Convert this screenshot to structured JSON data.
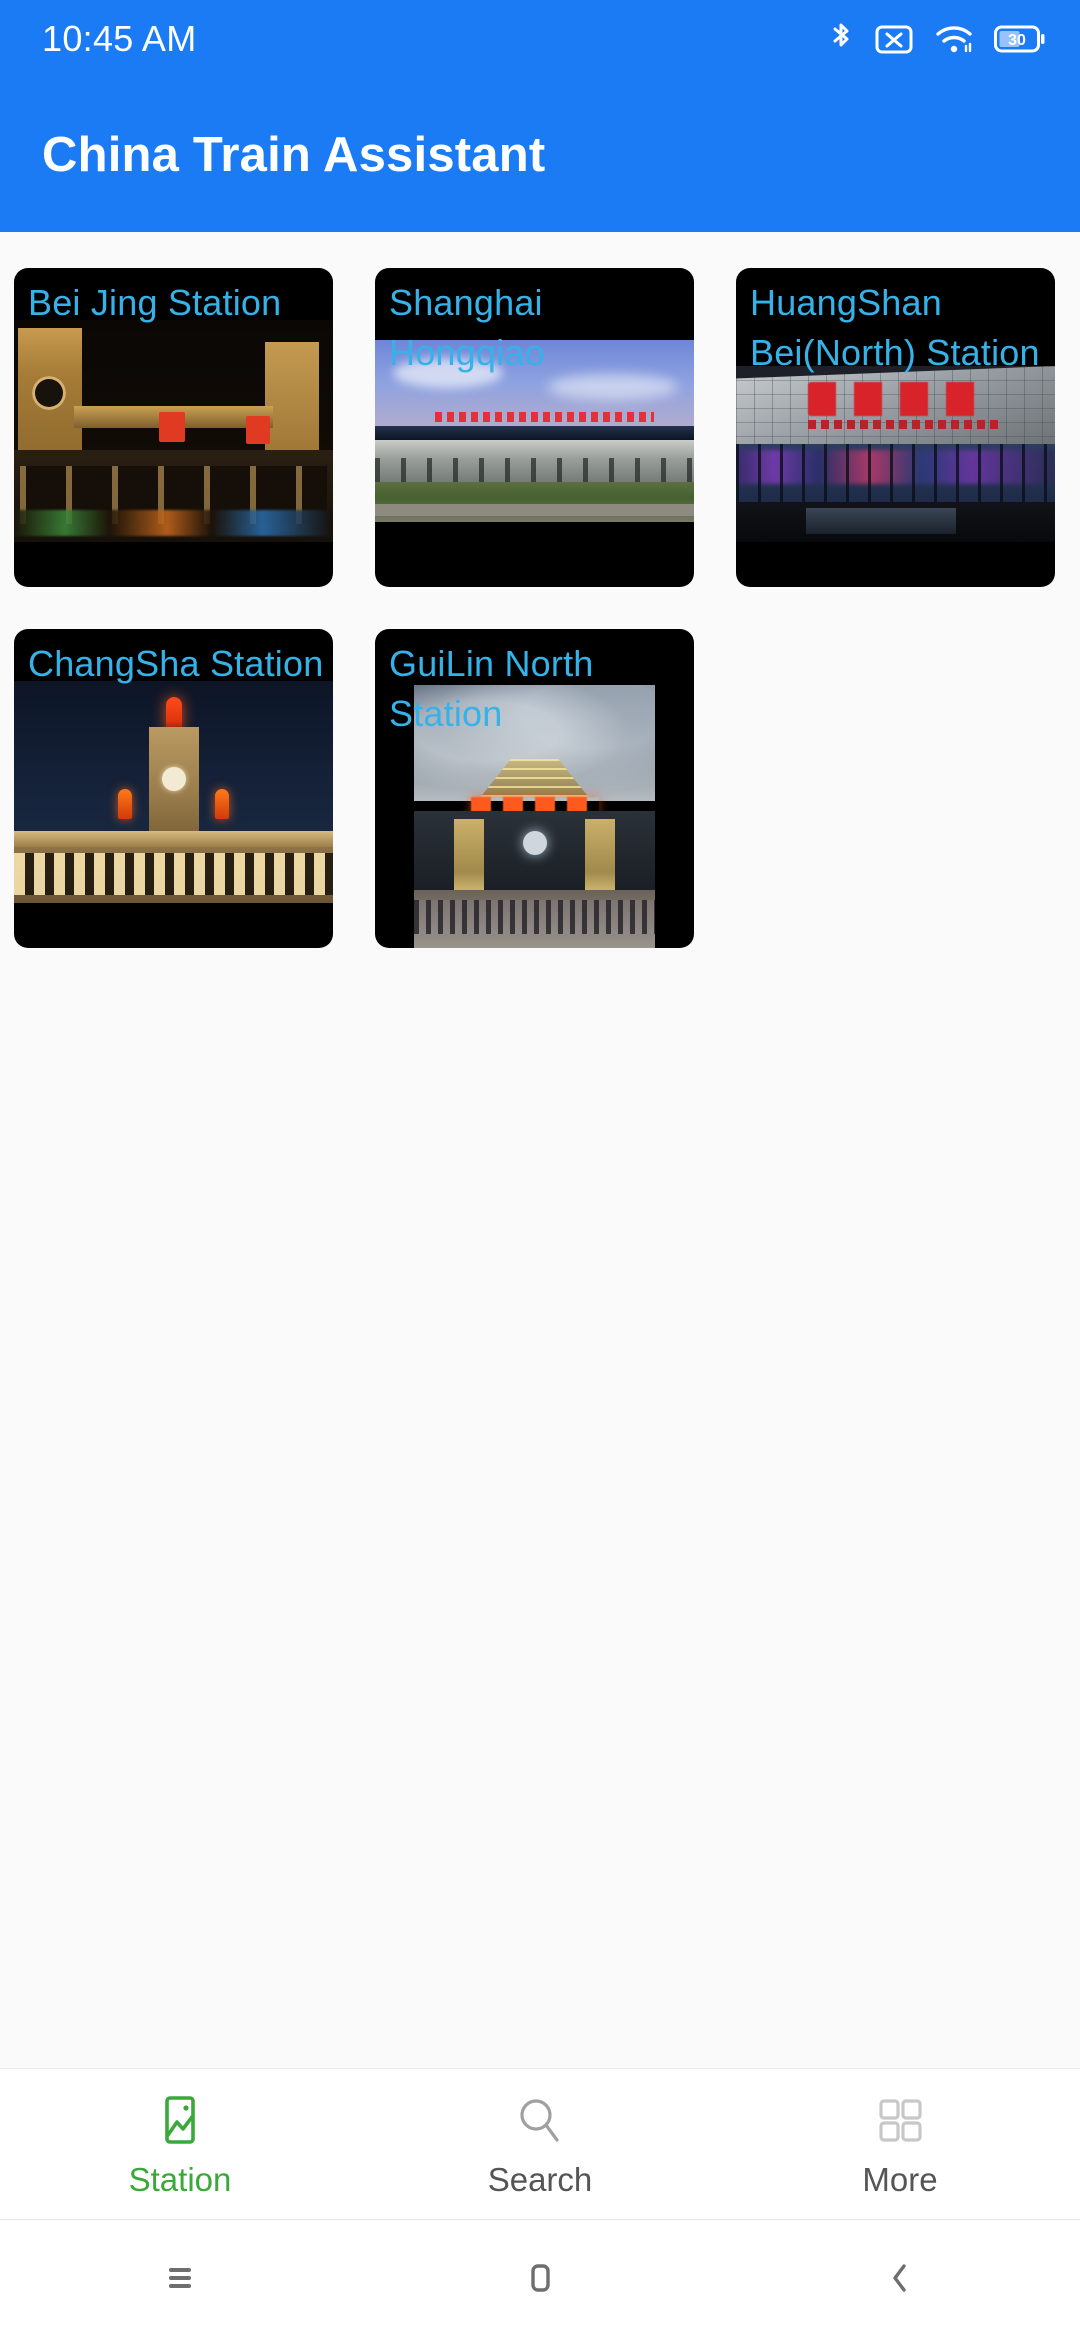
{
  "status_bar": {
    "time": "10:45 AM",
    "icons": [
      "bluetooth-icon",
      "sim-card-disabled-icon",
      "wifi-icon",
      "battery-icon"
    ],
    "battery_level": "30",
    "background_color": "#1a7bf5"
  },
  "app_bar": {
    "title": "China Train Assistant",
    "background_color": "#1a7bf5",
    "text_color": "#ffffff"
  },
  "theme": {
    "page_background": "#fafafa",
    "card_background": "#000000",
    "card_title_color": "#35b2e8",
    "nav_active_color": "#3aa93a",
    "nav_inactive_color": "#9b9b9b"
  },
  "stations": [
    {
      "name": "Bei Jing Station",
      "photo": "beijing-station-night-photo"
    },
    {
      "name": "Shanghai Hongqiao",
      "photo": "shanghai-hongqiao-station-photo"
    },
    {
      "name": "HuangShan\nBei(North) Station",
      "photo": "huangshan-north-station-photo"
    },
    {
      "name": "ChangSha Station",
      "photo": "changsha-station-night-photo"
    },
    {
      "name": "GuiLin North Station",
      "photo": "guilin-north-station-photo"
    }
  ],
  "bottom_nav": {
    "items": [
      {
        "label": "Station",
        "icon": "image-icon",
        "active": true
      },
      {
        "label": "Search",
        "icon": "search-icon",
        "active": false
      },
      {
        "label": "More",
        "icon": "grid-icon",
        "active": false
      }
    ]
  },
  "system_nav": {
    "recents": "recents-icon",
    "home": "home-icon",
    "back": "back-icon"
  }
}
